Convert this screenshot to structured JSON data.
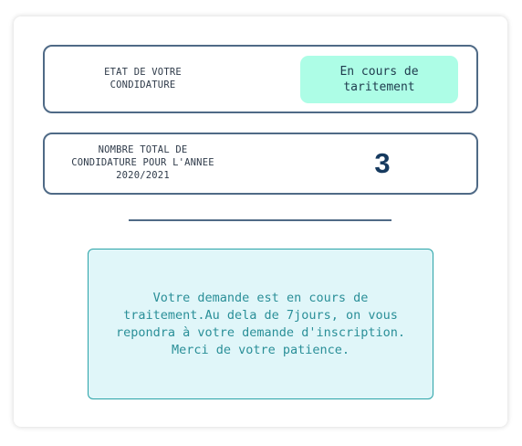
{
  "status_card": {
    "label": "ETAT DE VOTRE CONDIDATURE",
    "status": "En cours de\ntaritement"
  },
  "count_card": {
    "label": "NOMBRE TOTAL DE CONDIDATURE POUR L'ANNEE 2020/2021",
    "value": "3"
  },
  "message": {
    "text": "Votre demande est en cours de traitement.Au dela de 7jours, on vous repondra à votre demande d'inscription. Merci de votre patience."
  },
  "colors": {
    "border": "#4f6a86",
    "status_badge_bg": "#adfde6",
    "count_value": "#163a5f",
    "message_bg": "#e0f6f9",
    "message_text": "#2a8f98"
  }
}
